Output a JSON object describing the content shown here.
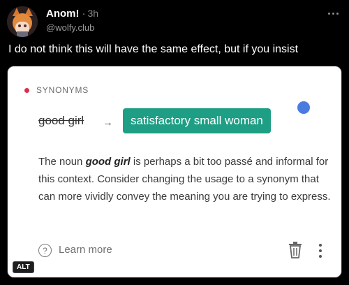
{
  "post": {
    "display_name": "Anom!",
    "separator": "·",
    "timestamp": "3h",
    "handle": "@wolfy.club",
    "text": "I do not think this will have the same effect, but if you insist"
  },
  "card": {
    "section_label": "SYNONYMS",
    "original_word": "good girl",
    "arrow": "→",
    "suggestion": "satisfactory small woman",
    "explanation_pre": "The noun ",
    "explanation_term": "good girl",
    "explanation_post": " is perhaps a bit too passé and informal for this context. Consider changing the usage to a synonym that can more vividly convey the meaning you are trying to express.",
    "help_glyph": "?",
    "learn_more": "Learn more"
  },
  "alt_badge": "ALT",
  "colors": {
    "background": "#000000",
    "suggestion_bg": "#1e9e84",
    "section_dot": "#d9304c",
    "pointer_dot": "#4a7be0"
  },
  "icons": [
    "avatar",
    "more-icon",
    "arrow-right-icon",
    "help-icon",
    "trash-icon",
    "kebab-icon"
  ]
}
